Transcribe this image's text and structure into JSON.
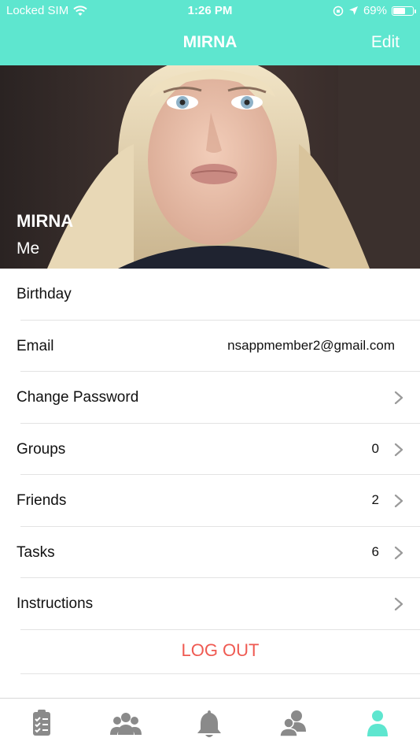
{
  "status_bar": {
    "carrier": "Locked SIM",
    "time": "1:26 PM",
    "battery_percent": "69%",
    "battery_level": 0.69
  },
  "nav": {
    "title": "MIRNA",
    "edit_label": "Edit"
  },
  "profile": {
    "name": "MIRNA",
    "subtitle": "Me"
  },
  "rows": [
    {
      "label": "Birthday",
      "value": ""
    },
    {
      "label": "Email",
      "value": "nsappmember2@gmail.com"
    },
    {
      "label": "Change Password",
      "value": ""
    },
    {
      "label": "Groups",
      "value": "0"
    },
    {
      "label": "Friends",
      "value": "2"
    },
    {
      "label": "Tasks",
      "value": "6"
    },
    {
      "label": "Instructions",
      "value": ""
    }
  ],
  "logout_label": "LOG OUT",
  "tabs": [
    {
      "icon": "checklist-icon",
      "active": false
    },
    {
      "icon": "group-icon",
      "active": false
    },
    {
      "icon": "bell-icon",
      "active": false
    },
    {
      "icon": "friends-icon",
      "active": false
    },
    {
      "icon": "person-icon",
      "active": true
    }
  ],
  "colors": {
    "accent": "#5ee6cf",
    "logout": "#ef5a52",
    "tab_inactive": "#8a8a8a"
  }
}
